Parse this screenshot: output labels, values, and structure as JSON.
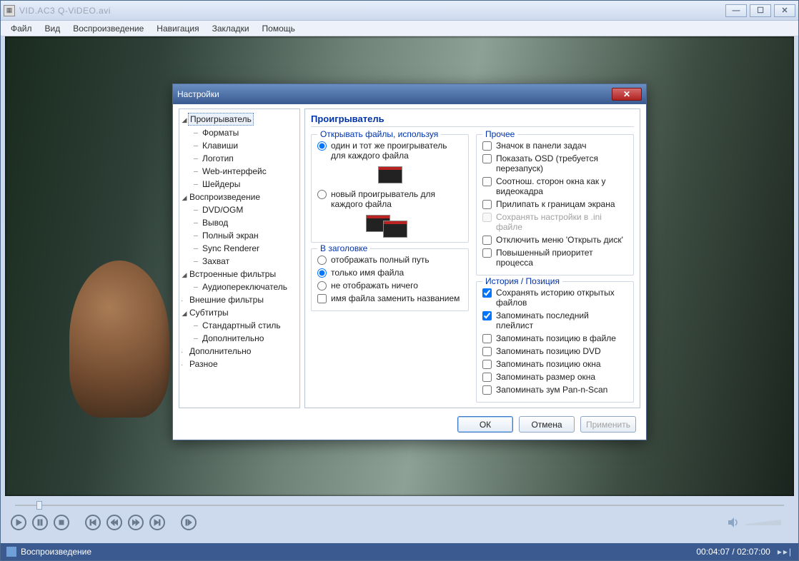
{
  "window": {
    "title_suffix": ".avi",
    "title_visible_part": "VID.AC3   Q-ViDEO.avi",
    "menu": [
      "Файл",
      "Вид",
      "Воспроизведение",
      "Навигация",
      "Закладки",
      "Помощь"
    ]
  },
  "status": {
    "state": "Воспроизведение",
    "time_current": "00:04:07",
    "time_total": "02:07:00"
  },
  "dialog": {
    "title": "Настройки",
    "header": "Проигрыватель",
    "tree": {
      "player": "Проигрыватель",
      "player_children": [
        "Форматы",
        "Клавиши",
        "Логотип",
        "Web-интерфейс",
        "Шейдеры"
      ],
      "playback": "Воспроизведение",
      "playback_children": [
        "DVD/OGM",
        "Вывод",
        "Полный экран",
        "Sync Renderer",
        "Захват"
      ],
      "builtin": "Встроенные фильтры",
      "builtin_children": [
        "Аудиопереключатель"
      ],
      "external": "Внешние фильтры",
      "subs": "Субтитры",
      "subs_children": [
        "Стандартный стиль",
        "Дополнительно"
      ],
      "advanced": "Дополнительно",
      "misc": "Разное"
    },
    "open_files": {
      "legend": "Открывать файлы, используя",
      "same": "один и тот же проигрыватель для каждого файла",
      "new": "новый проигрыватель для каждого файла"
    },
    "titlebar_group": {
      "legend": "В заголовке",
      "full": "отображать полный путь",
      "name": "только имя файла",
      "none": "не отображать ничего",
      "replace": "имя файла заменить названием"
    },
    "other": {
      "legend": "Прочее",
      "tray": "Значок в панели задач",
      "osd": "Показать OSD (требуется перезапуск)",
      "aspect": "Соотнош. сторон окна как у видеокадра",
      "snap": "Прилипать к границам экрана",
      "ini": "Сохранять настройки в .ini файле",
      "disc": "Отключить меню 'Открыть диск'",
      "prio": "Повышенный приоритет процесса"
    },
    "history": {
      "legend": "История / Позиция",
      "keep_hist": "Сохранять историю открытых файлов",
      "keep_playlist": "Запоминать последний плейлист",
      "pos_file": "Запоминать позицию в файле",
      "pos_dvd": "Запоминать позицию DVD",
      "pos_win": "Запоминать позицию окна",
      "size_win": "Запоминать размер окна",
      "zoom": "Запоминать зум Pan-n-Scan"
    },
    "buttons": {
      "ok": "ОК",
      "cancel": "Отмена",
      "apply": "Применить"
    }
  }
}
